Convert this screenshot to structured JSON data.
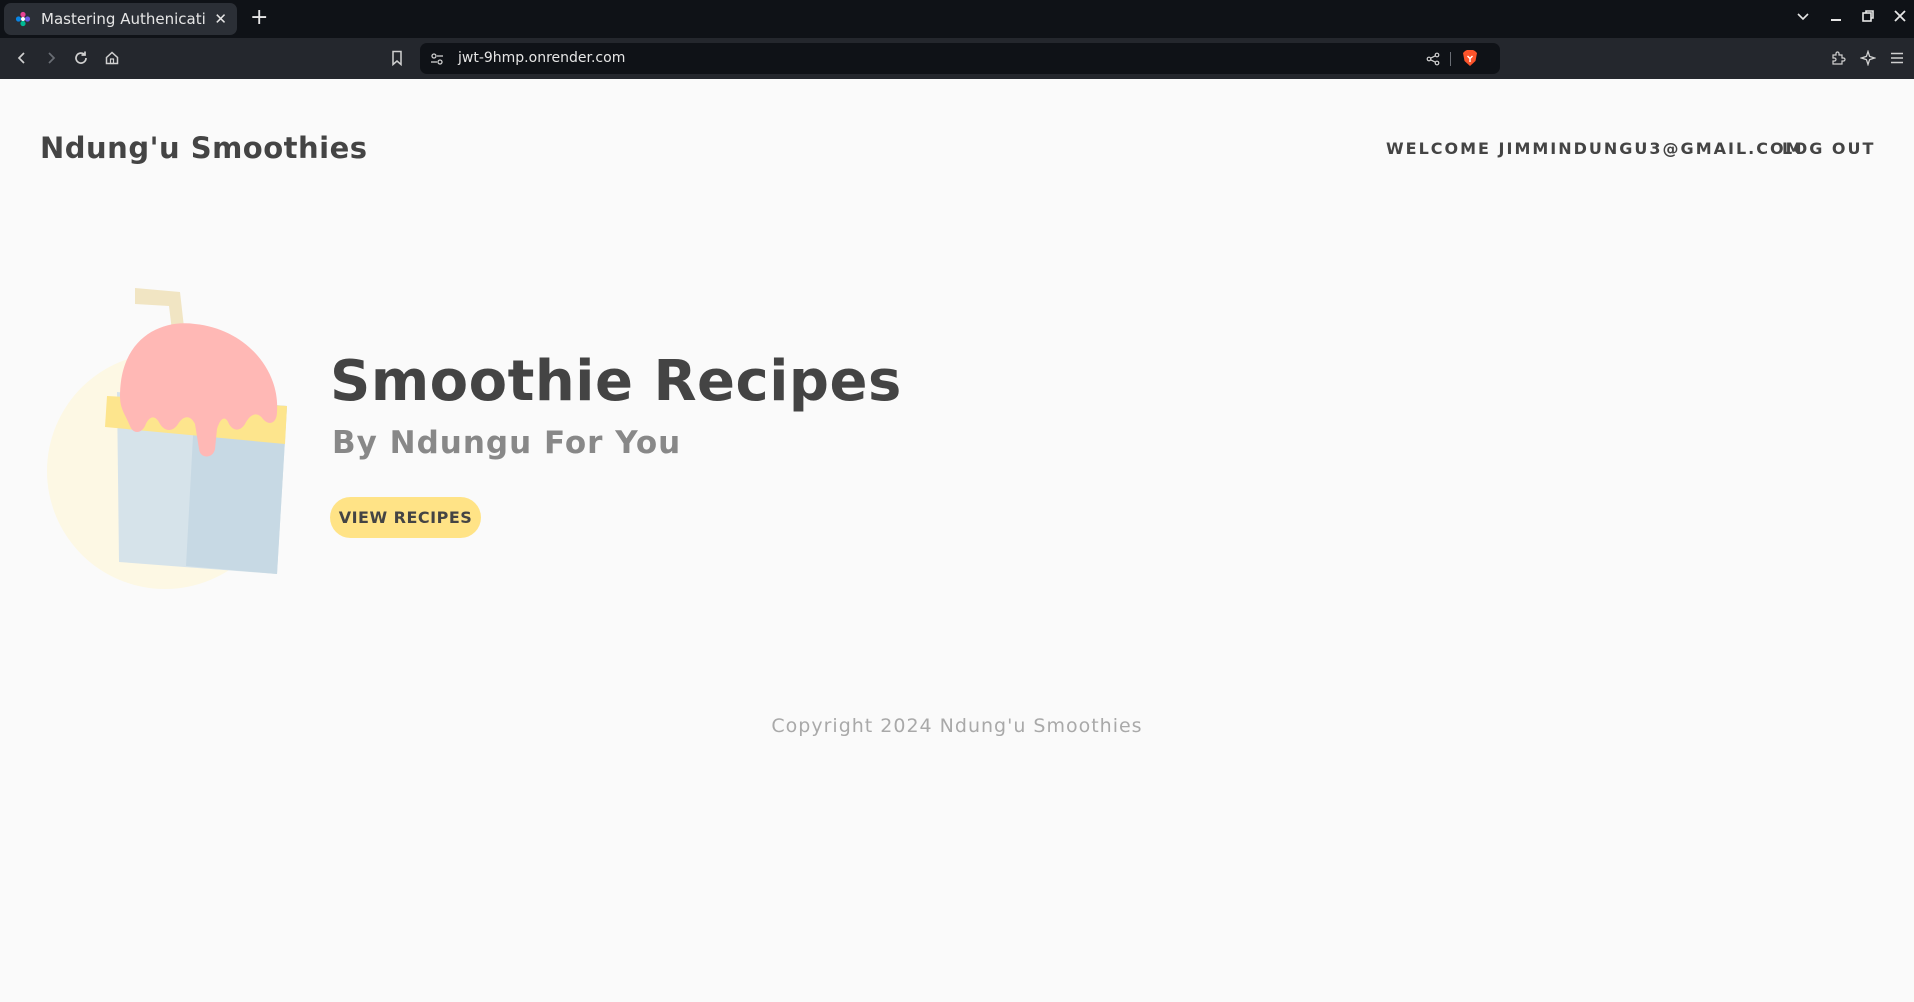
{
  "browser": {
    "tab_title": "Mastering Authenication",
    "url": "jwt-9hmp.onrender.com",
    "icons": [
      "favicon-icon",
      "close-icon",
      "new-tab-icon",
      "tab-list-icon",
      "minimize-icon",
      "restore-icon",
      "window-close-icon",
      "back-icon",
      "forward-icon",
      "reload-icon",
      "home-icon",
      "bookmark-icon",
      "site-info-icon",
      "share-icon",
      "brave-shields-icon",
      "extensions-icon",
      "leo-ai-icon",
      "menu-icon"
    ]
  },
  "header": {
    "brand": "Ndung'u Smoothies",
    "welcome": "WELCOME JIMMINDUNGU3@GMAIL.COM",
    "logout": "LOG OUT"
  },
  "hero": {
    "title": "Smoothie Recipes",
    "subtitle": "By Ndungu For You",
    "button_label": "VIEW RECIPES"
  },
  "footer": {
    "copyright": "Copyright 2024 Ndung'u Smoothies"
  },
  "colors": {
    "page_bg": "#fafafa",
    "text_dark": "#444444",
    "text_muted": "#888888",
    "button_bg": "#ffe386",
    "tabbar_bg": "#0f1217",
    "toolbar_bg": "#24272d"
  }
}
